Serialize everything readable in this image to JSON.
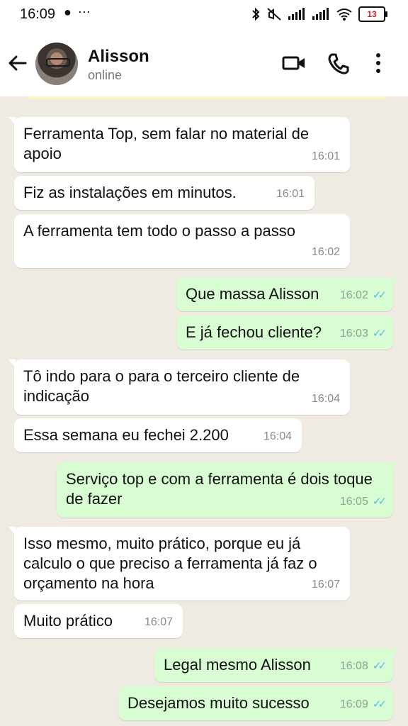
{
  "status_bar": {
    "time": "16:09",
    "left_icons": "● ⋯",
    "battery": "13"
  },
  "header": {
    "contact_name": "Alisson",
    "contact_status": "online"
  },
  "messages": [
    {
      "dir": "in",
      "text": "Ferramenta Top, sem falar no material de apoio",
      "time": "16:01"
    },
    {
      "dir": "in",
      "text": "Fiz as instalações em minutos.",
      "time": "16:01"
    },
    {
      "dir": "in",
      "text": "A ferramenta tem todo o passo a passo",
      "time": "16:02"
    },
    {
      "dir": "out",
      "text": "Que massa Alisson",
      "time": "16:02"
    },
    {
      "dir": "out",
      "text": "E já fechou cliente?",
      "time": "16:03"
    },
    {
      "dir": "in",
      "text": "Tô indo para o para o terceiro cliente de indicação",
      "time": "16:04"
    },
    {
      "dir": "in",
      "text": "Essa semana eu fechei 2.200",
      "time": "16:04"
    },
    {
      "dir": "out",
      "text": "Serviço top e com a ferramenta é dois toque de fazer",
      "time": "16:05"
    },
    {
      "dir": "in",
      "text": "Isso mesmo,  muito prático, porque eu já calculo o que preciso a ferramenta já faz o orçamento na hora",
      "time": "16:07"
    },
    {
      "dir": "in",
      "text": "Muito prático",
      "time": "16:07"
    },
    {
      "dir": "out",
      "text": "Legal mesmo Alisson",
      "time": "16:08"
    },
    {
      "dir": "out",
      "text": "Desejamos muito sucesso",
      "time": "16:09"
    }
  ],
  "colors": {
    "chat_background": "#efeae2",
    "incoming_bubble": "#ffffff",
    "outgoing_bubble": "#d9fdd3",
    "read_ticks": "#53bdeb"
  }
}
